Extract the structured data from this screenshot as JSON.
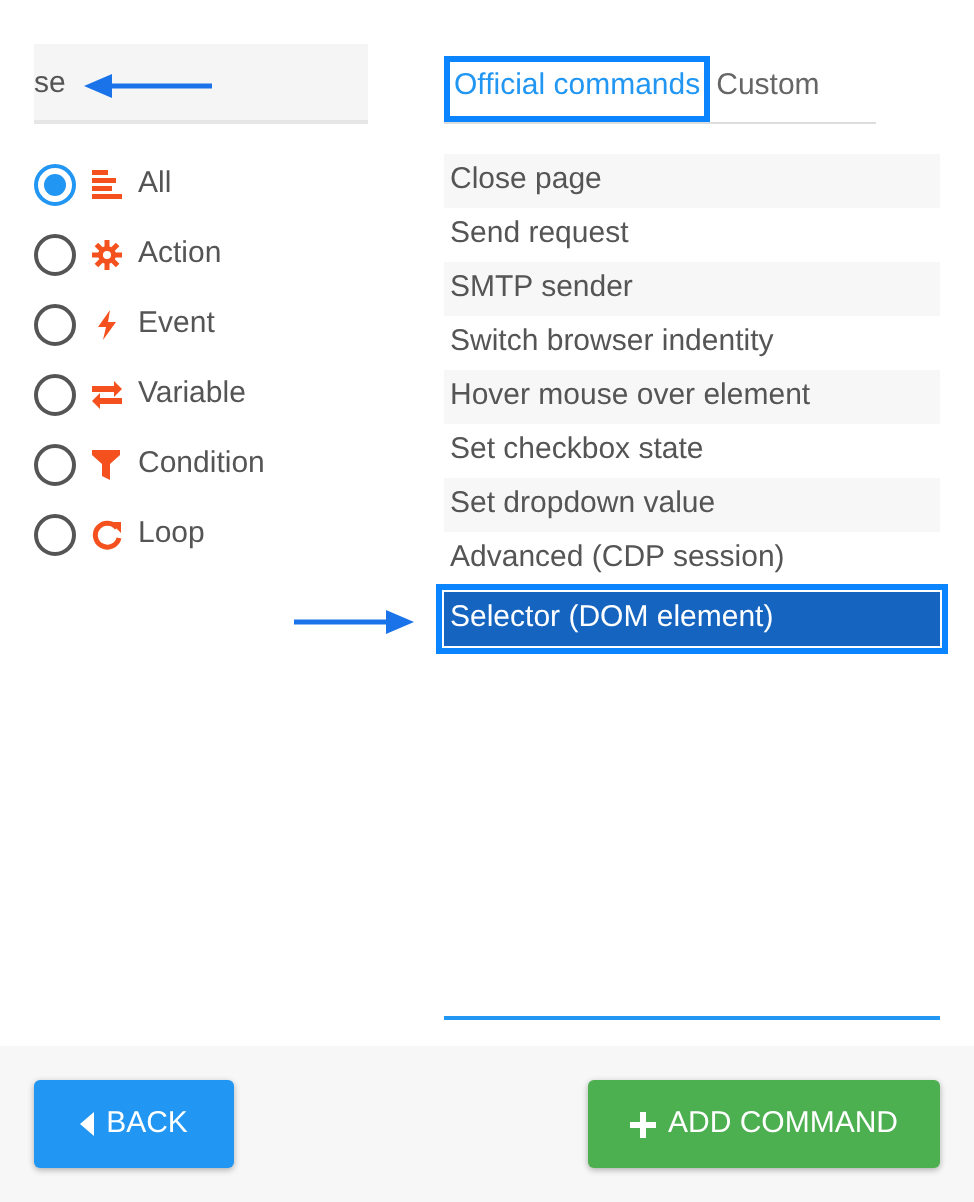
{
  "search": {
    "value": "se"
  },
  "filters": [
    {
      "label": "All",
      "kind": "all",
      "selected": true
    },
    {
      "label": "Action",
      "kind": "action",
      "selected": false
    },
    {
      "label": "Event",
      "kind": "event",
      "selected": false
    },
    {
      "label": "Variable",
      "kind": "variable",
      "selected": false
    },
    {
      "label": "Condition",
      "kind": "condition",
      "selected": false
    },
    {
      "label": "Loop",
      "kind": "loop",
      "selected": false
    }
  ],
  "tabs": [
    {
      "label": "Official commands",
      "selected": true
    },
    {
      "label": "Custom",
      "selected": false
    }
  ],
  "commands": [
    {
      "label": "Close page",
      "selected": false
    },
    {
      "label": "Send request",
      "selected": false
    },
    {
      "label": "SMTP sender",
      "selected": false
    },
    {
      "label": "Switch browser indentity",
      "selected": false
    },
    {
      "label": "Hover mouse over element",
      "selected": false
    },
    {
      "label": "Set checkbox state",
      "selected": false
    },
    {
      "label": "Set dropdown value",
      "selected": false
    },
    {
      "label": "Advanced (CDP session)",
      "selected": false
    },
    {
      "label": "Selector (DOM element)",
      "selected": true
    }
  ],
  "buttons": [
    {
      "label": "BACK",
      "kind": "back"
    },
    {
      "label": "ADD COMMAND",
      "kind": "add"
    }
  ]
}
